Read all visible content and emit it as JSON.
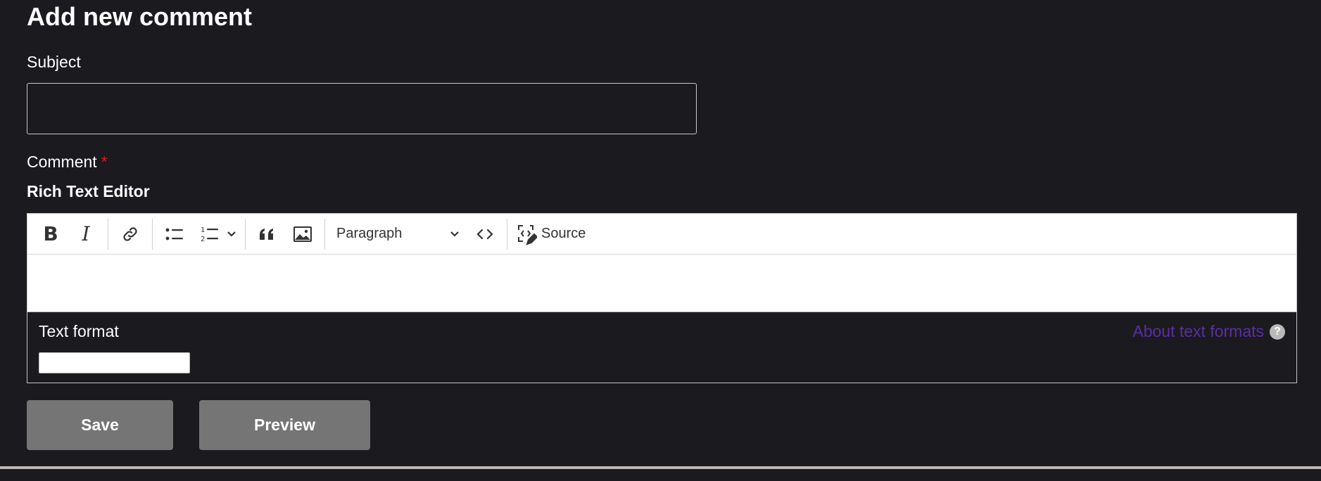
{
  "form": {
    "title": "Add new comment",
    "subject_label": "Subject",
    "subject_value": "",
    "comment_label": "Comment",
    "required_marker": "*",
    "editor_label": "Rich Text Editor"
  },
  "toolbar": {
    "bold": "B",
    "italic": "I",
    "heading_select": "Paragraph",
    "source_label": "Source"
  },
  "text_format": {
    "label": "Text format",
    "about_link": "About text formats",
    "help_glyph": "?"
  },
  "actions": {
    "save": "Save",
    "preview": "Preview"
  },
  "colors": {
    "background": "#1b1a1f",
    "button": "#757575",
    "link": "#5a2ea6",
    "required": "#e31a1a"
  }
}
